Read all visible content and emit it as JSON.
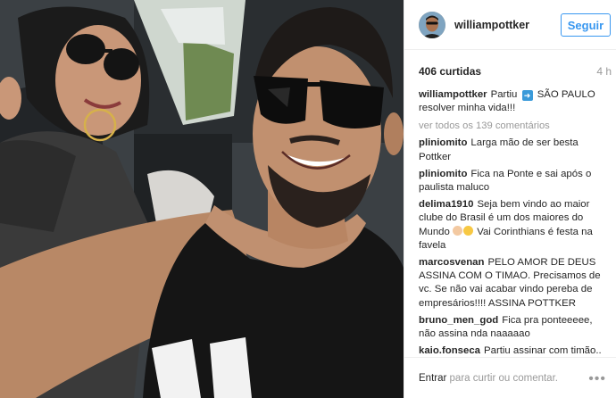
{
  "post": {
    "username": "williampottker",
    "follow_label": "Seguir",
    "likes_text": "406 curtidas",
    "time_text": "4 h",
    "caption": {
      "user": "williampottker",
      "text_before": "Partiu",
      "icon": "arrow-right-icon",
      "text_after": "SÃO PAULO resolver minha vida!!!"
    },
    "view_all_text": "ver todos os 139 comentários",
    "comments": [
      {
        "user": "pliniomito",
        "text": "Larga mão de ser besta Pottker"
      },
      {
        "user": "pliniomito",
        "text": "Fica na Ponte e sai após o paulista maluco"
      },
      {
        "user": "delima1910",
        "text": "Seja bem vindo ao maior clube do Brasil é um dos maiores do Mundo",
        "text_after_emoji": "Vai Corinthians é festa na favela"
      },
      {
        "user": "marcosvenan",
        "text": "PELO AMOR DE DEUS ASSINA COM O TIMAO. Precisamos de vc. Se não vai acabar vindo pereba de empresários!!!! ASSINA POTTKER"
      },
      {
        "user": "bruno_men_god",
        "text": "Fica pra ponteeeee, não assina nda naaaaao"
      },
      {
        "user": "kaio.fonseca",
        "text": "Partiu assinar com timão.. vai Corinthians"
      }
    ],
    "footer": {
      "login_label": "Entrar",
      "rest": " para curtir ou comentar."
    }
  },
  "colors": {
    "accent": "#3897f0",
    "text": "#262626",
    "muted": "#999999",
    "border": "#efefef"
  }
}
